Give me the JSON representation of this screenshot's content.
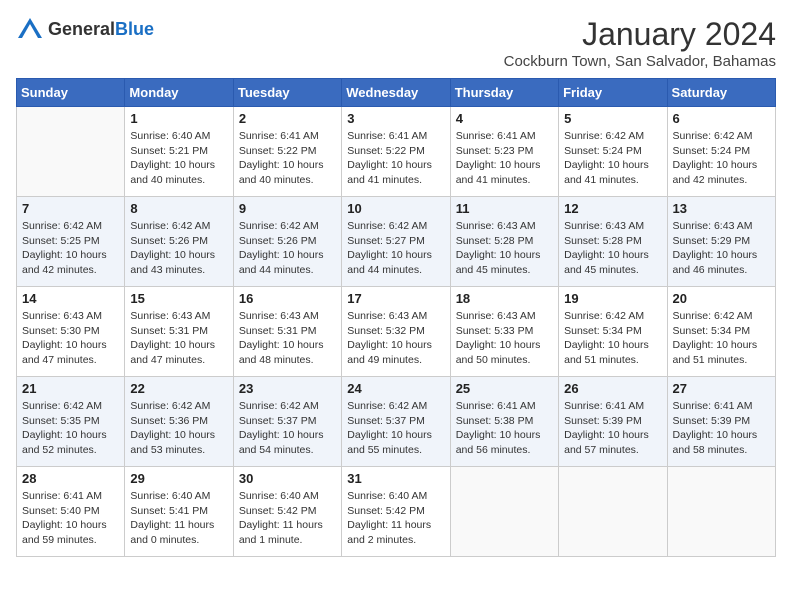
{
  "header": {
    "logo_general": "General",
    "logo_blue": "Blue",
    "title": "January 2024",
    "subtitle": "Cockburn Town, San Salvador, Bahamas"
  },
  "days_of_week": [
    "Sunday",
    "Monday",
    "Tuesday",
    "Wednesday",
    "Thursday",
    "Friday",
    "Saturday"
  ],
  "weeks": [
    [
      {
        "day": "",
        "sunrise": "",
        "sunset": "",
        "daylight": ""
      },
      {
        "day": "1",
        "sunrise": "Sunrise: 6:40 AM",
        "sunset": "Sunset: 5:21 PM",
        "daylight": "Daylight: 10 hours and 40 minutes."
      },
      {
        "day": "2",
        "sunrise": "Sunrise: 6:41 AM",
        "sunset": "Sunset: 5:22 PM",
        "daylight": "Daylight: 10 hours and 40 minutes."
      },
      {
        "day": "3",
        "sunrise": "Sunrise: 6:41 AM",
        "sunset": "Sunset: 5:22 PM",
        "daylight": "Daylight: 10 hours and 41 minutes."
      },
      {
        "day": "4",
        "sunrise": "Sunrise: 6:41 AM",
        "sunset": "Sunset: 5:23 PM",
        "daylight": "Daylight: 10 hours and 41 minutes."
      },
      {
        "day": "5",
        "sunrise": "Sunrise: 6:42 AM",
        "sunset": "Sunset: 5:24 PM",
        "daylight": "Daylight: 10 hours and 41 minutes."
      },
      {
        "day": "6",
        "sunrise": "Sunrise: 6:42 AM",
        "sunset": "Sunset: 5:24 PM",
        "daylight": "Daylight: 10 hours and 42 minutes."
      }
    ],
    [
      {
        "day": "7",
        "sunrise": "Sunrise: 6:42 AM",
        "sunset": "Sunset: 5:25 PM",
        "daylight": "Daylight: 10 hours and 42 minutes."
      },
      {
        "day": "8",
        "sunrise": "Sunrise: 6:42 AM",
        "sunset": "Sunset: 5:26 PM",
        "daylight": "Daylight: 10 hours and 43 minutes."
      },
      {
        "day": "9",
        "sunrise": "Sunrise: 6:42 AM",
        "sunset": "Sunset: 5:26 PM",
        "daylight": "Daylight: 10 hours and 44 minutes."
      },
      {
        "day": "10",
        "sunrise": "Sunrise: 6:42 AM",
        "sunset": "Sunset: 5:27 PM",
        "daylight": "Daylight: 10 hours and 44 minutes."
      },
      {
        "day": "11",
        "sunrise": "Sunrise: 6:43 AM",
        "sunset": "Sunset: 5:28 PM",
        "daylight": "Daylight: 10 hours and 45 minutes."
      },
      {
        "day": "12",
        "sunrise": "Sunrise: 6:43 AM",
        "sunset": "Sunset: 5:28 PM",
        "daylight": "Daylight: 10 hours and 45 minutes."
      },
      {
        "day": "13",
        "sunrise": "Sunrise: 6:43 AM",
        "sunset": "Sunset: 5:29 PM",
        "daylight": "Daylight: 10 hours and 46 minutes."
      }
    ],
    [
      {
        "day": "14",
        "sunrise": "Sunrise: 6:43 AM",
        "sunset": "Sunset: 5:30 PM",
        "daylight": "Daylight: 10 hours and 47 minutes."
      },
      {
        "day": "15",
        "sunrise": "Sunrise: 6:43 AM",
        "sunset": "Sunset: 5:31 PM",
        "daylight": "Daylight: 10 hours and 47 minutes."
      },
      {
        "day": "16",
        "sunrise": "Sunrise: 6:43 AM",
        "sunset": "Sunset: 5:31 PM",
        "daylight": "Daylight: 10 hours and 48 minutes."
      },
      {
        "day": "17",
        "sunrise": "Sunrise: 6:43 AM",
        "sunset": "Sunset: 5:32 PM",
        "daylight": "Daylight: 10 hours and 49 minutes."
      },
      {
        "day": "18",
        "sunrise": "Sunrise: 6:43 AM",
        "sunset": "Sunset: 5:33 PM",
        "daylight": "Daylight: 10 hours and 50 minutes."
      },
      {
        "day": "19",
        "sunrise": "Sunrise: 6:42 AM",
        "sunset": "Sunset: 5:34 PM",
        "daylight": "Daylight: 10 hours and 51 minutes."
      },
      {
        "day": "20",
        "sunrise": "Sunrise: 6:42 AM",
        "sunset": "Sunset: 5:34 PM",
        "daylight": "Daylight: 10 hours and 51 minutes."
      }
    ],
    [
      {
        "day": "21",
        "sunrise": "Sunrise: 6:42 AM",
        "sunset": "Sunset: 5:35 PM",
        "daylight": "Daylight: 10 hours and 52 minutes."
      },
      {
        "day": "22",
        "sunrise": "Sunrise: 6:42 AM",
        "sunset": "Sunset: 5:36 PM",
        "daylight": "Daylight: 10 hours and 53 minutes."
      },
      {
        "day": "23",
        "sunrise": "Sunrise: 6:42 AM",
        "sunset": "Sunset: 5:37 PM",
        "daylight": "Daylight: 10 hours and 54 minutes."
      },
      {
        "day": "24",
        "sunrise": "Sunrise: 6:42 AM",
        "sunset": "Sunset: 5:37 PM",
        "daylight": "Daylight: 10 hours and 55 minutes."
      },
      {
        "day": "25",
        "sunrise": "Sunrise: 6:41 AM",
        "sunset": "Sunset: 5:38 PM",
        "daylight": "Daylight: 10 hours and 56 minutes."
      },
      {
        "day": "26",
        "sunrise": "Sunrise: 6:41 AM",
        "sunset": "Sunset: 5:39 PM",
        "daylight": "Daylight: 10 hours and 57 minutes."
      },
      {
        "day": "27",
        "sunrise": "Sunrise: 6:41 AM",
        "sunset": "Sunset: 5:39 PM",
        "daylight": "Daylight: 10 hours and 58 minutes."
      }
    ],
    [
      {
        "day": "28",
        "sunrise": "Sunrise: 6:41 AM",
        "sunset": "Sunset: 5:40 PM",
        "daylight": "Daylight: 10 hours and 59 minutes."
      },
      {
        "day": "29",
        "sunrise": "Sunrise: 6:40 AM",
        "sunset": "Sunset: 5:41 PM",
        "daylight": "Daylight: 11 hours and 0 minutes."
      },
      {
        "day": "30",
        "sunrise": "Sunrise: 6:40 AM",
        "sunset": "Sunset: 5:42 PM",
        "daylight": "Daylight: 11 hours and 1 minute."
      },
      {
        "day": "31",
        "sunrise": "Sunrise: 6:40 AM",
        "sunset": "Sunset: 5:42 PM",
        "daylight": "Daylight: 11 hours and 2 minutes."
      },
      {
        "day": "",
        "sunrise": "",
        "sunset": "",
        "daylight": ""
      },
      {
        "day": "",
        "sunrise": "",
        "sunset": "",
        "daylight": ""
      },
      {
        "day": "",
        "sunrise": "",
        "sunset": "",
        "daylight": ""
      }
    ]
  ]
}
